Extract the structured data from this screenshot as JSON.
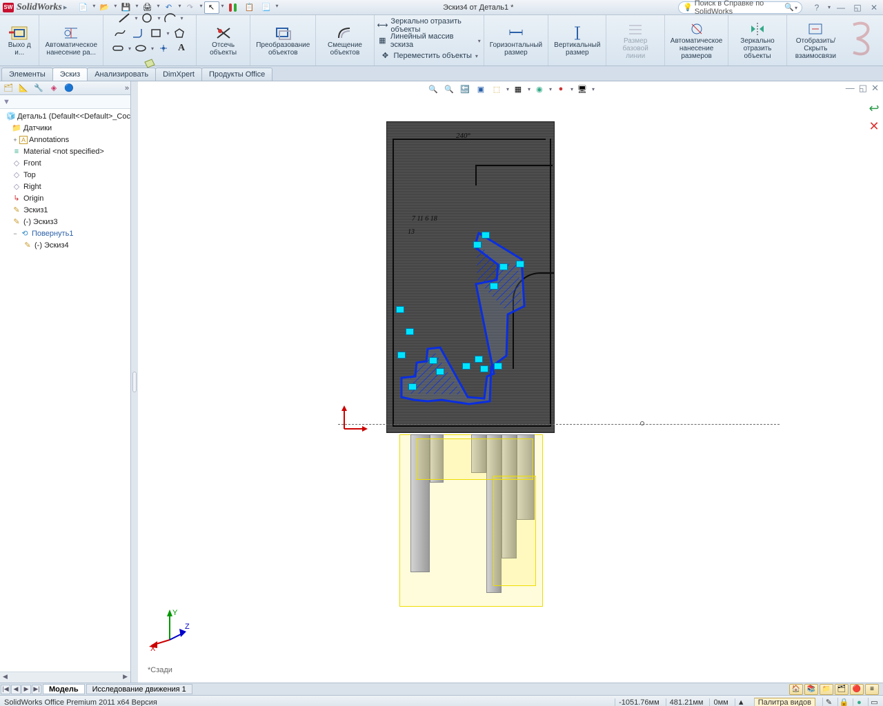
{
  "title_logo": "SW",
  "title_brand": "SolidWorks",
  "doc_title": "Эскиз4 от Деталь1 *",
  "search_placeholder": "Поиск в Справке по SolidWorks",
  "help_q": "?",
  "ribbon": {
    "exit_sketch": "Выхо д и...",
    "auto_dim": "Автоматическое нанесение ра...",
    "trim": "Отсечь объекты",
    "convert": "Преобразование объектов",
    "offset": "Смещение объектов",
    "mirror": "Зеркально отразить объекты",
    "linear": "Линейный массив эскиза",
    "move": "Переместить объекты",
    "hdim": "Горизонтальный размер",
    "vdim": "Вертикальный размер",
    "baseline": "Размер базовой линии",
    "autodim2": "Автоматическое нанесение размеров",
    "mirror2": "Зеркально отразить объекты",
    "showhide": "Отобразить/Скрыть взаимосвязи"
  },
  "tabs": {
    "features": "Элементы",
    "sketch": "Эскиз",
    "analyze": "Анализировать",
    "dimxpert": "DimXpert",
    "office": "Продукты Office"
  },
  "tree": {
    "root": "Деталь1 (Default<<Default>_Сос",
    "sensors": "Датчики",
    "annotations": "Annotations",
    "material": "Material <not specified>",
    "front": "Front",
    "top": "Top",
    "right": "Right",
    "origin": "Origin",
    "sketch1": "Эскиз1",
    "sketch3": "(-) Эскиз3",
    "revolve": "Повернуть1",
    "sketch4": "(-) Эскиз4"
  },
  "view_label": "*Сзади",
  "bottom_tabs": {
    "model": "Модель",
    "motion": "Исследование движения 1"
  },
  "status": {
    "product": "SolidWorks Office Premium 2011 x64 Версия",
    "x": "-1051.76мм",
    "y": "481.21мм",
    "z": "0мм",
    "palette": "Палитра видов"
  }
}
